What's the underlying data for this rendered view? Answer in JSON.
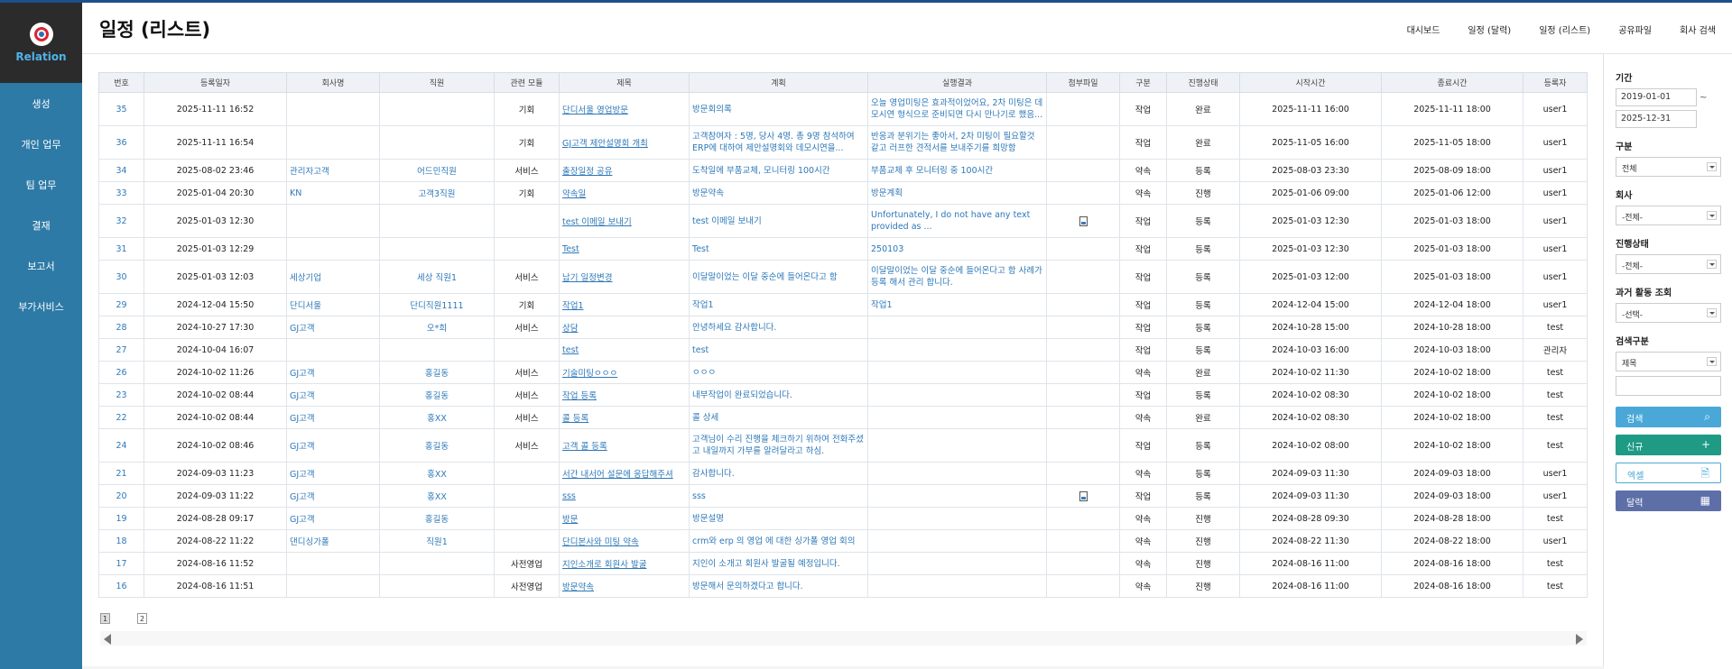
{
  "app": {
    "name": "Relation"
  },
  "sidebar": {
    "items": [
      "생성",
      "개인 업무",
      "팀 업무",
      "결재",
      "보고서",
      "부가서비스"
    ]
  },
  "header": {
    "title": "일정 (리스트)",
    "menu": [
      "대시보드",
      "일정 (달력)",
      "일정 (리스트)",
      "공유파일",
      "회사 검색"
    ]
  },
  "table": {
    "columns": [
      "번호",
      "등록일자",
      "회사명",
      "직원",
      "관련 모듈",
      "제목",
      "계획",
      "실행결과",
      "첨부파일",
      "구분",
      "진행상태",
      "시작시간",
      "종료시간",
      "등록자"
    ],
    "rows": [
      {
        "no": "35",
        "date": "2025-11-11 16:52",
        "company": "",
        "staff": "",
        "module": "기회",
        "title": "단디서울 영업방문",
        "plan": "방문회의록",
        "result": "오늘 영업미팅은 효과적이었어요, 2차 미팅은 데모시연 형식으로 준비되면 다시 만나기로 했음...",
        "file": false,
        "type": "작업",
        "status": "완료",
        "start": "2025-11-11 16:00",
        "end": "2025-11-11 18:00",
        "user": "user1",
        "tall": true
      },
      {
        "no": "36",
        "date": "2025-11-11 16:54",
        "company": "",
        "staff": "",
        "module": "기회",
        "title": "GJ고객 제안설명회 개최",
        "plan": "고객참여자 : 5명, 당사 4명. 총 9명 참석하여 ERP에 대하여 제안설명회와 데모시연을...",
        "result": "반응과 분위기는 좋아서, 2차 미팅이 필요할것 같고 러프한 견적서를 보내주기를 희망함",
        "file": false,
        "type": "작업",
        "status": "완료",
        "start": "2025-11-05 16:00",
        "end": "2025-11-05 18:00",
        "user": "user1",
        "tall": true
      },
      {
        "no": "34",
        "date": "2025-08-02 23:46",
        "company": "관리자고객",
        "staff": "어드민직원",
        "module": "서비스",
        "title": "출장일정 공유",
        "plan": "도착일에 부품교체, 모니터링 100시간",
        "result": "부품교체 후 모니터링 중 100시간",
        "file": false,
        "type": "약속",
        "status": "등록",
        "start": "2025-08-03 23:30",
        "end": "2025-08-09 18:00",
        "user": "user1",
        "tall": false
      },
      {
        "no": "33",
        "date": "2025-01-04 20:30",
        "company": "KN",
        "staff": "고객3직원",
        "module": "기회",
        "title": "약속일",
        "plan": "방문약속",
        "result": "방문계획",
        "file": false,
        "type": "약속",
        "status": "진행",
        "start": "2025-01-06 09:00",
        "end": "2025-01-06 12:00",
        "user": "user1",
        "tall": false
      },
      {
        "no": "32",
        "date": "2025-01-03 12:30",
        "company": "",
        "staff": "",
        "module": "",
        "title": "test 이메일 보내기",
        "plan": "test 이메일 보내기",
        "result": "Unfortunately, I do not have any text provided as ...",
        "file": true,
        "type": "작업",
        "status": "등록",
        "start": "2025-01-03 12:30",
        "end": "2025-01-03 18:00",
        "user": "user1",
        "tall": true
      },
      {
        "no": "31",
        "date": "2025-01-03 12:29",
        "company": "",
        "staff": "",
        "module": "",
        "title": "Test",
        "plan": "Test",
        "result": "250103",
        "file": false,
        "type": "작업",
        "status": "등록",
        "start": "2025-01-03 12:30",
        "end": "2025-01-03 18:00",
        "user": "user1",
        "tall": false
      },
      {
        "no": "30",
        "date": "2025-01-03 12:03",
        "company": "세상기업",
        "staff": "세상 직원1",
        "module": "서비스",
        "title": "납기 일정변경",
        "plan": "이달말이었는 이달 중순에 들어온다고 함",
        "result": "이달말이었는 이달 중순에 들어온다고 함 사례가 등록 해서 관리 합니다.",
        "file": false,
        "type": "작업",
        "status": "등록",
        "start": "2025-01-03 12:00",
        "end": "2025-01-03 18:00",
        "user": "user1",
        "tall": true
      },
      {
        "no": "29",
        "date": "2024-12-04 15:50",
        "company": "단디서울",
        "staff": "단디직원1111",
        "module": "기회",
        "title": "작업1",
        "plan": "작업1",
        "result": "작업1",
        "file": false,
        "type": "작업",
        "status": "등록",
        "start": "2024-12-04 15:00",
        "end": "2024-12-04 18:00",
        "user": "user1",
        "tall": false
      },
      {
        "no": "28",
        "date": "2024-10-27 17:30",
        "company": "GJ고객",
        "staff": "오*희",
        "module": "서비스",
        "title": "상담",
        "plan": "안녕하세요   감사합니다.",
        "result": "",
        "file": false,
        "type": "작업",
        "status": "등록",
        "start": "2024-10-28 15:00",
        "end": "2024-10-28 18:00",
        "user": "test",
        "tall": false
      },
      {
        "no": "27",
        "date": "2024-10-04 16:07",
        "company": "",
        "staff": "",
        "module": "",
        "title": "test",
        "plan": "test",
        "result": "",
        "file": false,
        "type": "작업",
        "status": "등록",
        "start": "2024-10-03 16:00",
        "end": "2024-10-03 18:00",
        "user": "관리자",
        "tall": false
      },
      {
        "no": "26",
        "date": "2024-10-02 11:26",
        "company": "GJ고객",
        "staff": "홍길동",
        "module": "서비스",
        "title": "기술미팅ㅇㅇㅇ",
        "plan": "ㅇㅇㅇ",
        "result": "",
        "file": false,
        "type": "약속",
        "status": "완료",
        "start": "2024-10-02 11:30",
        "end": "2024-10-02 18:00",
        "user": "test",
        "tall": false
      },
      {
        "no": "23",
        "date": "2024-10-02 08:44",
        "company": "GJ고객",
        "staff": "홍길동",
        "module": "서비스",
        "title": "작업 등록",
        "plan": "내부작업이 완료되었습니다.",
        "result": "",
        "file": false,
        "type": "작업",
        "status": "등록",
        "start": "2024-10-02 08:30",
        "end": "2024-10-02 18:00",
        "user": "test",
        "tall": false
      },
      {
        "no": "22",
        "date": "2024-10-02 08:44",
        "company": "GJ고객",
        "staff": "홍XX",
        "module": "서비스",
        "title": "콜 등록",
        "plan": "콜 상세",
        "result": "",
        "file": false,
        "type": "약속",
        "status": "완료",
        "start": "2024-10-02 08:30",
        "end": "2024-10-02 18:00",
        "user": "test",
        "tall": false
      },
      {
        "no": "24",
        "date": "2024-10-02 08:46",
        "company": "GJ고객",
        "staff": "홍길동",
        "module": "서비스",
        "title": "고객 콜 등록",
        "plan": "고객님이 수리 진행을 체크하기 위하여 전화주셨고 내일까지 가부를 알려달라고 하심.",
        "result": "",
        "file": false,
        "type": "작업",
        "status": "등록",
        "start": "2024-10-02 08:00",
        "end": "2024-10-02 18:00",
        "user": "test",
        "tall": true
      },
      {
        "no": "21",
        "date": "2024-09-03 11:23",
        "company": "GJ고객",
        "staff": "홍XX",
        "module": "",
        "title": "서간 내서어 설문에 응답해주셔",
        "plan": "감사합니다.",
        "result": "",
        "file": false,
        "type": "약속",
        "status": "등록",
        "start": "2024-09-03 11:30",
        "end": "2024-09-03 18:00",
        "user": "user1",
        "tall": false
      },
      {
        "no": "20",
        "date": "2024-09-03 11:22",
        "company": "GJ고객",
        "staff": "홍XX",
        "module": "",
        "title": "sss",
        "plan": "sss",
        "result": "",
        "file": true,
        "type": "작업",
        "status": "등록",
        "start": "2024-09-03 11:30",
        "end": "2024-09-03 18:00",
        "user": "user1",
        "tall": false
      },
      {
        "no": "19",
        "date": "2024-08-28 09:17",
        "company": "GJ고객",
        "staff": "홍길동",
        "module": "",
        "title": "방문",
        "plan": "방문설명",
        "result": "",
        "file": false,
        "type": "약속",
        "status": "진행",
        "start": "2024-08-28 09:30",
        "end": "2024-08-28 18:00",
        "user": "test",
        "tall": false
      },
      {
        "no": "18",
        "date": "2024-08-22 11:22",
        "company": "댄디싱가폴",
        "staff": "직원1",
        "module": "",
        "title": "단디본사와 미팅 약속",
        "plan": "crm와 erp 의 영업 에 대한 싱가폴 영업 회의",
        "result": "",
        "file": false,
        "type": "약속",
        "status": "진행",
        "start": "2024-08-22 11:30",
        "end": "2024-08-22 18:00",
        "user": "user1",
        "tall": false
      },
      {
        "no": "17",
        "date": "2024-08-16 11:52",
        "company": "",
        "staff": "",
        "module": "사전영업",
        "title": "지인소개로 회원사 발굴",
        "plan": "지인이 소개고 회원사 발굴될 예정입니다.",
        "result": "",
        "file": false,
        "type": "약속",
        "status": "진행",
        "start": "2024-08-16 11:00",
        "end": "2024-08-16 18:00",
        "user": "test",
        "tall": false
      },
      {
        "no": "16",
        "date": "2024-08-16 11:51",
        "company": "",
        "staff": "",
        "module": "사전영업",
        "title": "방문약속",
        "plan": "방문해서 문의하겠다고 합니다.",
        "result": "",
        "file": false,
        "type": "약속",
        "status": "진행",
        "start": "2024-08-16 11:00",
        "end": "2024-08-16 18:00",
        "user": "test",
        "tall": false
      }
    ]
  },
  "pager": {
    "pages": [
      "1",
      "2"
    ]
  },
  "filters": {
    "period_label": "기간",
    "date_from": "2019-01-01",
    "tilde": "~",
    "date_to": "2025-12-31",
    "type_label": "구분",
    "type_value": "전체",
    "company_label": "회사",
    "company_value": "-전체-",
    "status_label": "진행상태",
    "status_value": "-전체-",
    "past_label": "과거 활동 조회",
    "past_value": "-선택-",
    "search_type_label": "검색구분",
    "search_type_value": "제목",
    "search_text": ""
  },
  "buttons": {
    "search": "검색",
    "new": "신규",
    "excel": "엑셀",
    "calendar": "달력"
  },
  "colors": {
    "sidebar": "#2e7aa6",
    "logo_bg": "#2b2b2b",
    "link": "#2d78b8",
    "search_btn": "#4aa8d8",
    "new_btn": "#1e9a85",
    "calendar_btn": "#5e6fa8"
  }
}
